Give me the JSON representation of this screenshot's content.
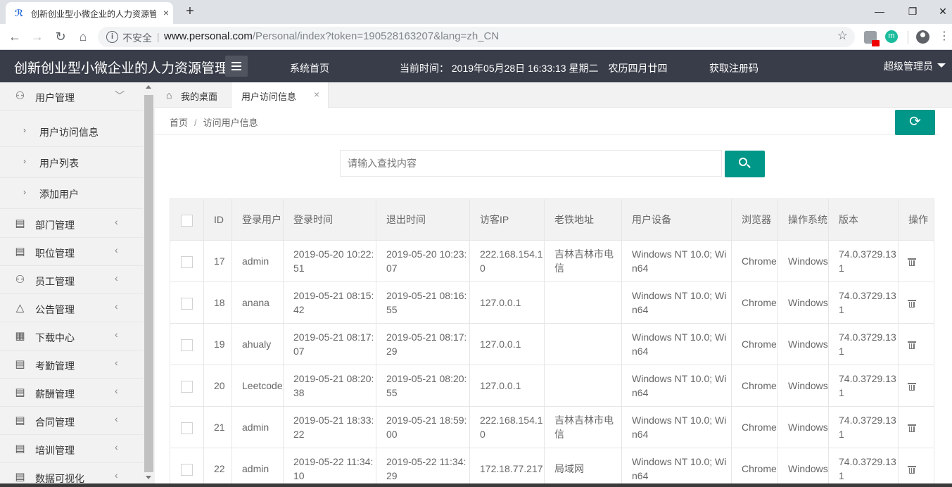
{
  "browser": {
    "tab_title": "创新创业型小微企业的人力资源管",
    "tab_close": "×",
    "new_tab": "+",
    "security_label": "不安全",
    "url_host": "www.personal.com",
    "url_path": "/Personal/index?token=190528163207&lang=zh_CN",
    "window_minimize": "—",
    "window_restore": "❐",
    "window_close": "✕",
    "ext2_label": "m"
  },
  "header": {
    "app_title": "创新创业型小微企业的人力资源管理",
    "nav_home": "系统首页",
    "clock": "当前时间： 2019年05月28日 16:33:13 星期二　农历四月廿四",
    "register": "获取注册码",
    "user": "超级管理员"
  },
  "sidebar": {
    "user_menu": {
      "label": "用户管理",
      "icon": "user-icon",
      "expanded": true
    },
    "sub_items": [
      {
        "label": "用户访问信息"
      },
      {
        "label": "用户列表"
      },
      {
        "label": "添加用户"
      }
    ],
    "items": [
      {
        "label": "部门管理",
        "icon": "document-icon"
      },
      {
        "label": "职位管理",
        "icon": "document-icon"
      },
      {
        "label": "员工管理",
        "icon": "users-icon"
      },
      {
        "label": "公告管理",
        "icon": "bell-icon"
      },
      {
        "label": "下载中心",
        "icon": "grid-icon"
      },
      {
        "label": "考勤管理",
        "icon": "document-icon"
      },
      {
        "label": "薪酬管理",
        "icon": "document-icon"
      },
      {
        "label": "合同管理",
        "icon": "document-icon"
      },
      {
        "label": "培训管理",
        "icon": "document-icon"
      },
      {
        "label": "数据可视化",
        "icon": "document-icon"
      }
    ]
  },
  "content_tabs": {
    "home": "我的桌面",
    "active": "用户访问信息"
  },
  "breadcrumb": {
    "home": "首页",
    "separator": "/",
    "current": "访问用户信息"
  },
  "search": {
    "placeholder": "请输入查找内容"
  },
  "colors": {
    "accent": "#009688",
    "header_bg": "#393d49"
  },
  "table": {
    "columns": [
      "ID",
      "登录用户",
      "登录时间",
      "退出时间",
      "访客IP",
      "老铁地址",
      "用户设备",
      "浏览器",
      "操作系统",
      "版本",
      "操作"
    ],
    "rows": [
      [
        "17",
        "admin",
        "2019-05-20 10:22:51",
        "2019-05-20 10:23:07",
        "222.168.154.10",
        "吉林吉林市电信",
        "Windows NT 10.0; Win64",
        "Chrome",
        "Windows",
        "74.0.3729.131"
      ],
      [
        "18",
        "anana",
        "2019-05-21 08:15:42",
        "2019-05-21 08:16:55",
        "127.0.0.1",
        "",
        "Windows NT 10.0; Win64",
        "Chrome",
        "Windows",
        "74.0.3729.131"
      ],
      [
        "19",
        "ahualy",
        "2019-05-21 08:17:07",
        "2019-05-21 08:17:29",
        "127.0.0.1",
        "",
        "Windows NT 10.0; Win64",
        "Chrome",
        "Windows",
        "74.0.3729.131"
      ],
      [
        "20",
        "Leetcode",
        "2019-05-21 08:20:38",
        "2019-05-21 08:20:55",
        "127.0.0.1",
        "",
        "Windows NT 10.0; Win64",
        "Chrome",
        "Windows",
        "74.0.3729.131"
      ],
      [
        "21",
        "admin",
        "2019-05-21 18:33:22",
        "2019-05-21 18:59:00",
        "222.168.154.10",
        "吉林吉林市电信",
        "Windows NT 10.0; Win64",
        "Chrome",
        "Windows",
        "74.0.3729.131"
      ],
      [
        "22",
        "admin",
        "2019-05-22 11:34:10",
        "2019-05-22 11:34:29",
        "172.18.77.217",
        "局域网",
        "Windows NT 10.0; Win64",
        "Chrome",
        "Windows",
        "74.0.3729.131"
      ]
    ]
  }
}
